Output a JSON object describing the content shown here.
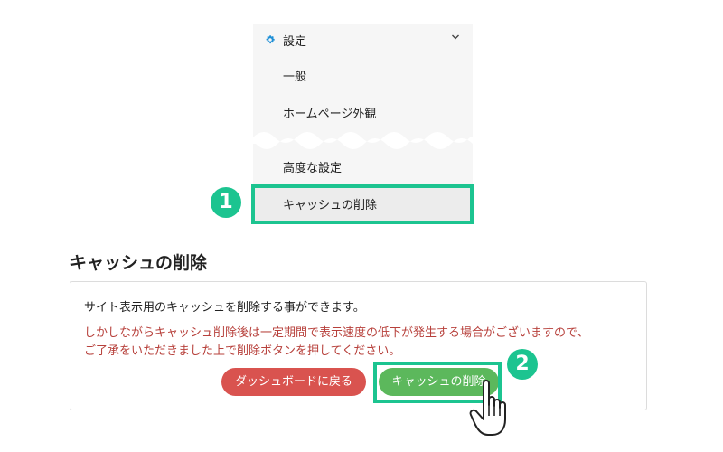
{
  "menu": {
    "title": "設定",
    "items": [
      "一般",
      "ホームページ外観",
      "高度な設定"
    ],
    "active_item": "キャッシュの削除"
  },
  "badges": [
    "1",
    "2"
  ],
  "section": {
    "title": "キャッシュの削除",
    "info": "サイト表示用のキャッシュを削除する事ができます。",
    "warning_line1": "しかしながらキャッシュ削除後は一定期間で表示速度の低下が発生する場合がございますので、",
    "warning_line2": "ご了承をいただきました上で削除ボタンを押してください。"
  },
  "buttons": {
    "back": "ダッシュボードに戻る",
    "clear": "キャッシュの削除"
  },
  "icons": {
    "settings": "gear-icon",
    "expand": "chevron-down-icon",
    "pointer": "hand-pointer-icon"
  },
  "colors": {
    "highlight": "#1cc490",
    "gear": "#1e8fd6",
    "danger_button": "#d9534f",
    "success_button": "#5cb85c",
    "warning_text": "#b7403b"
  }
}
